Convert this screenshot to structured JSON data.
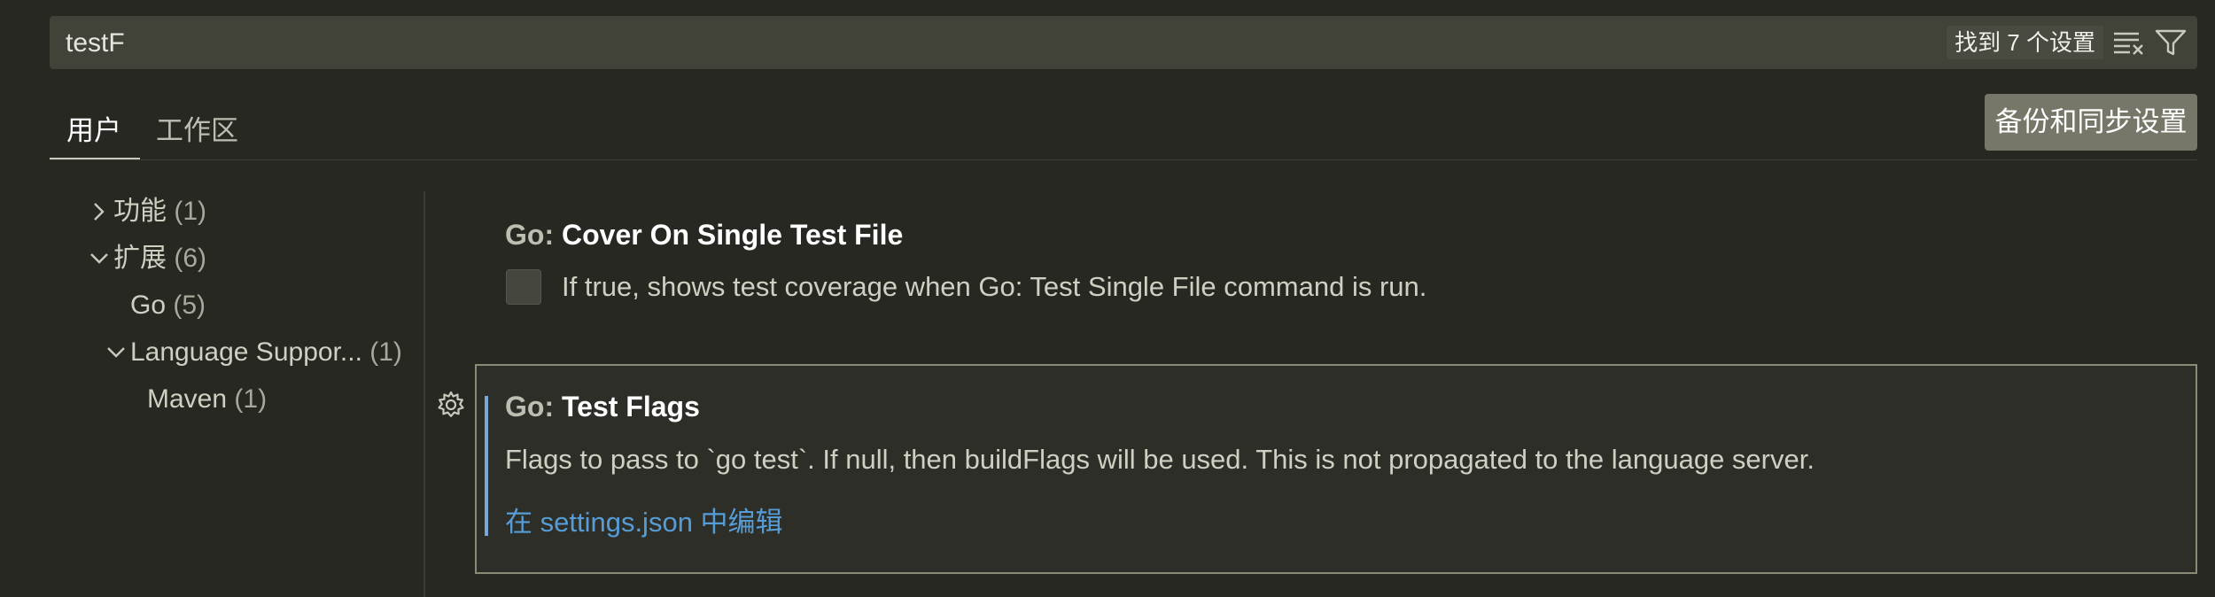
{
  "search": {
    "value": "testF",
    "result_count": "找到 7 个设置"
  },
  "tabs": [
    {
      "label": "用户"
    },
    {
      "label": "工作区"
    }
  ],
  "sync_button": "备份和同步设置",
  "toc": [
    {
      "label": "功能",
      "count": "(1)",
      "expanded": false
    },
    {
      "label": "扩展",
      "count": "(6)",
      "expanded": true
    },
    {
      "label": "Go",
      "count": "(5)"
    },
    {
      "label": "Language Suppor...",
      "count": "(1)",
      "expanded": true
    },
    {
      "label": "Maven",
      "count": "(1)"
    }
  ],
  "settings": [
    {
      "category": "Go: ",
      "name": "Cover On Single Test File",
      "description": "If true, shows test coverage when Go: Test Single File command is run.",
      "checked": false
    },
    {
      "category": "Go: ",
      "name": "Test Flags",
      "description": "Flags to pass to `go test`. If null, then buildFlags will be used. This is not propagated to the language server.",
      "link": "在 settings.json 中编辑"
    }
  ],
  "colors": {
    "accent_link": "#569cd6",
    "focus_border": "#8a8a76",
    "background": "#272822"
  }
}
